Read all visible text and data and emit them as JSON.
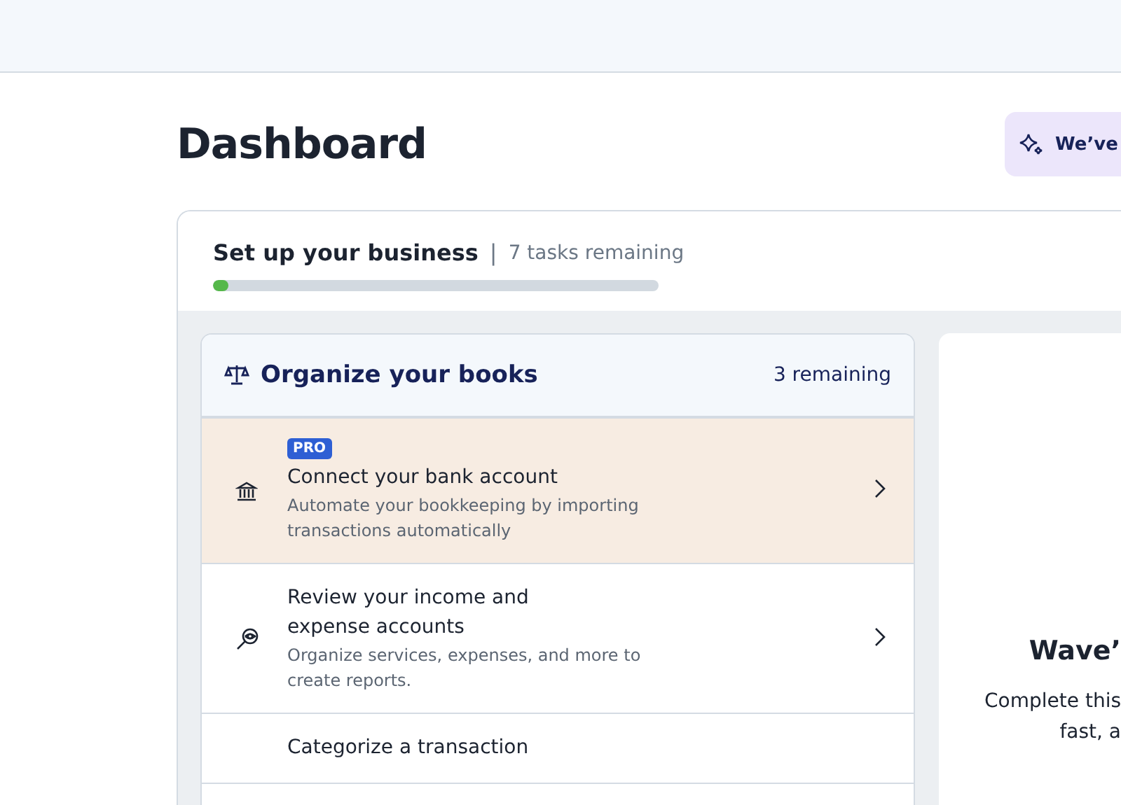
{
  "page": {
    "title": "Dashboard"
  },
  "banner": {
    "text": "We’ve"
  },
  "setup": {
    "title": "Set up your business",
    "separator": "|",
    "subtitle": "7 tasks remaining",
    "level": 0.035
  },
  "section": {
    "title": "Organize your books",
    "count": "3 remaining",
    "tasks": [
      {
        "kind": "bank",
        "badge": "PRO",
        "title": "Connect your bank account",
        "description": "Automate your bookkeeping by importing transactions automatically",
        "highlighted": true
      },
      {
        "kind": "review",
        "title": "Review your income and expense accounts",
        "description": "Organize services, expenses, and more to create reports.",
        "highlighted": false
      },
      {
        "kind": "categorize",
        "title": "Categorize a transaction",
        "highlighted": false
      }
    ]
  },
  "side_panel": {
    "heading": "Wave’",
    "lines": [
      "Complete this",
      "fast, a"
    ]
  }
}
